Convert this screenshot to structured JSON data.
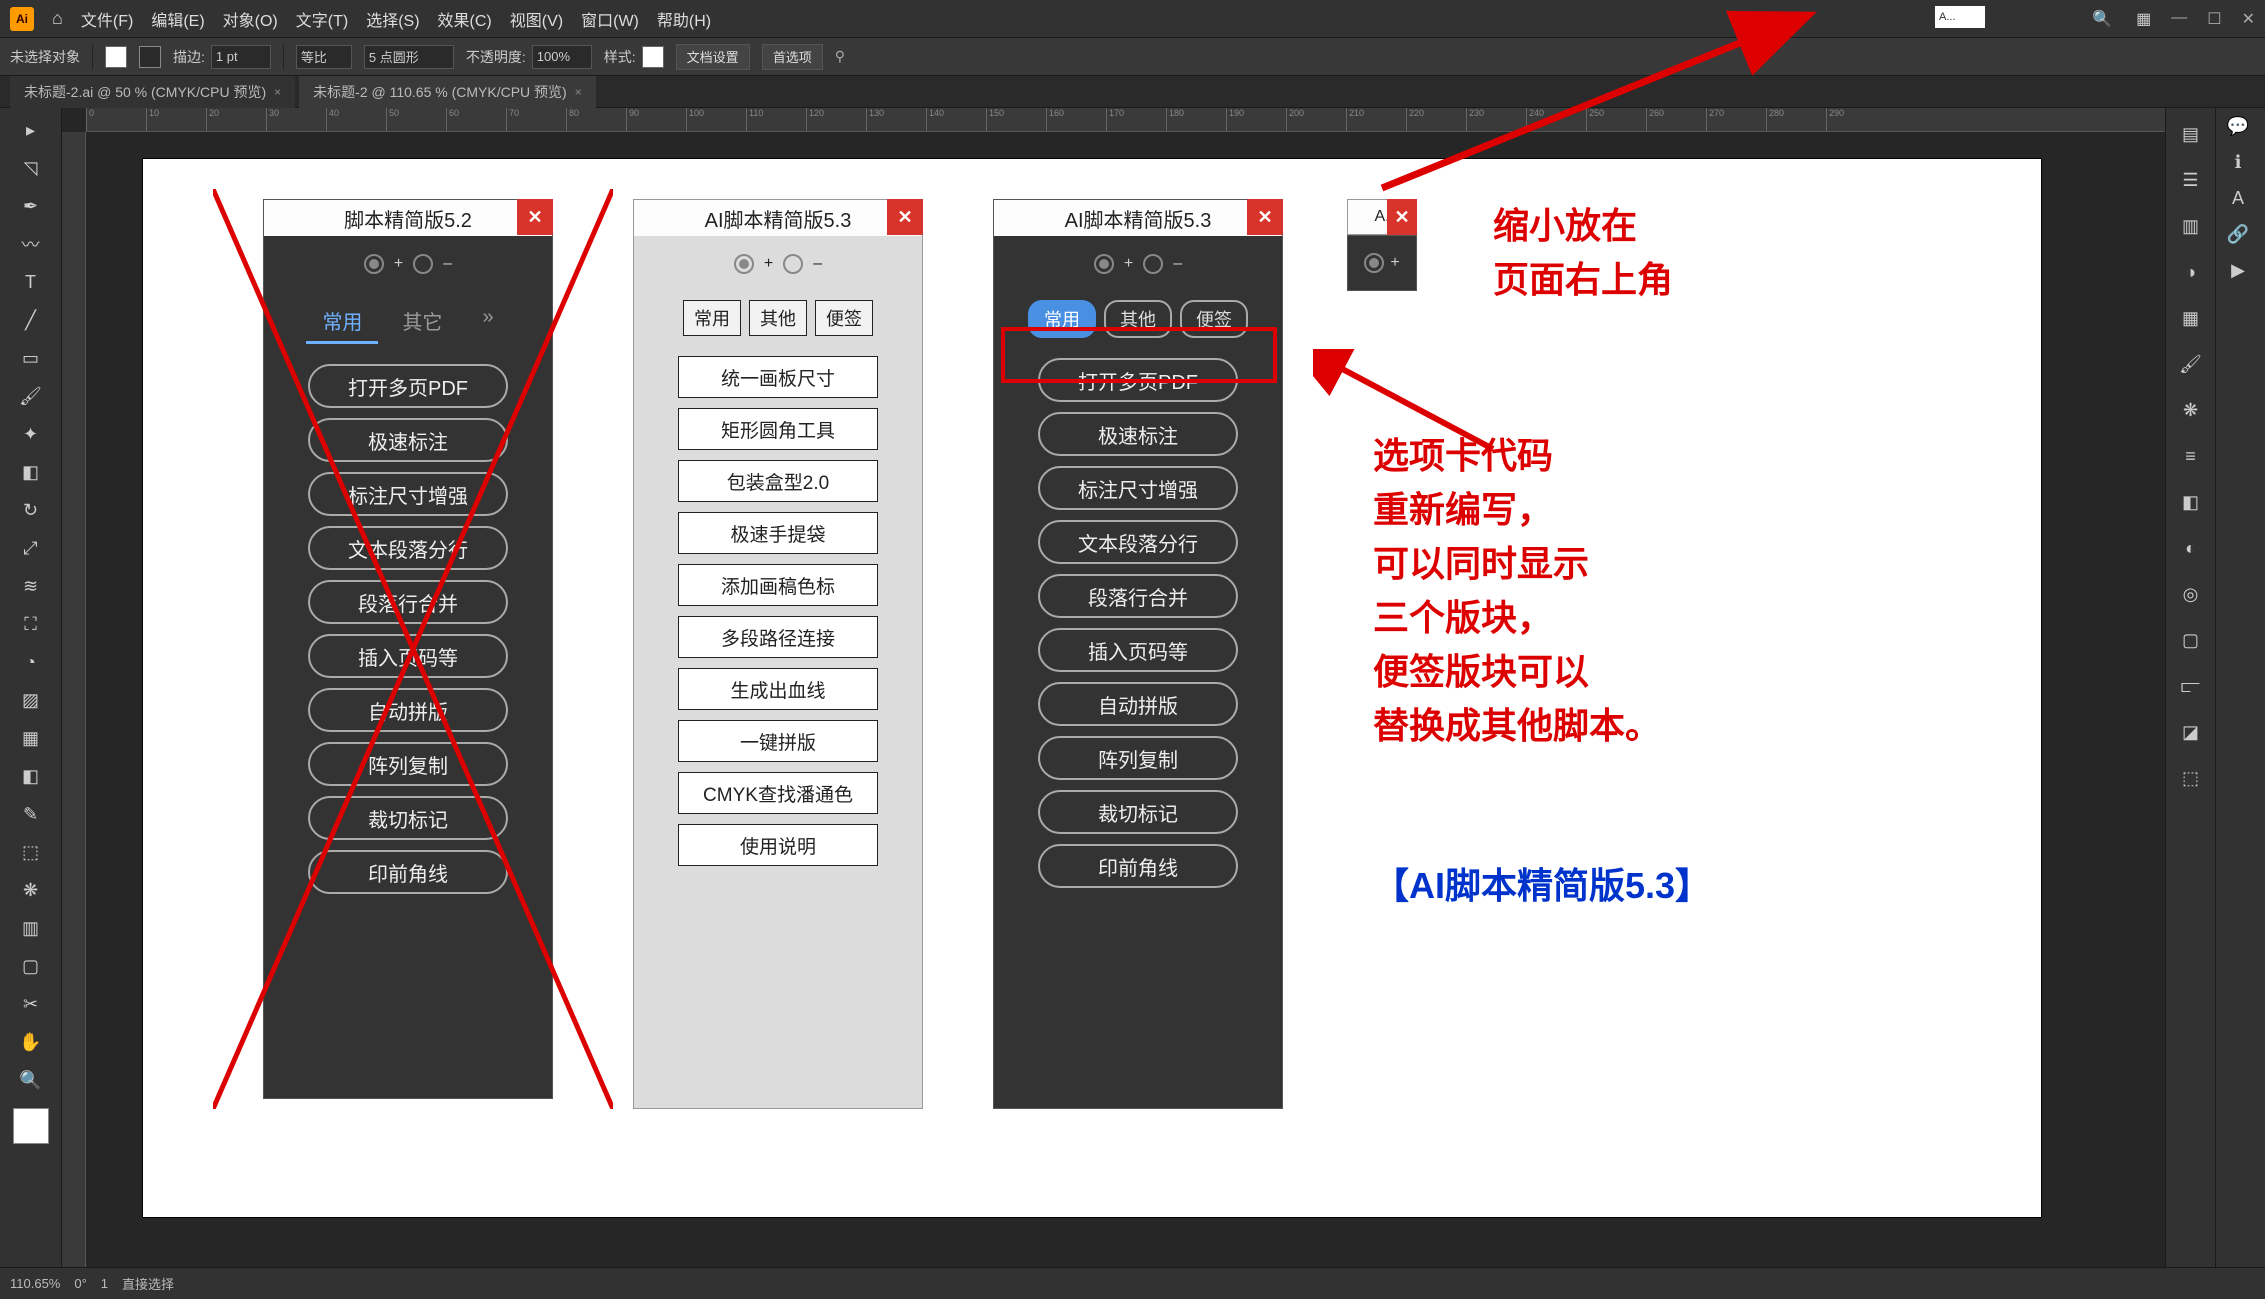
{
  "app": {
    "logo": "Ai"
  },
  "menu": [
    "文件(F)",
    "编辑(E)",
    "对象(O)",
    "文字(T)",
    "选择(S)",
    "效果(C)",
    "视图(V)",
    "窗口(W)",
    "帮助(H)"
  ],
  "search_chip": "A...",
  "control": {
    "no_selection": "未选择对象",
    "stroke_label": "描边:",
    "stroke_value": "1 pt",
    "uniform": "等比",
    "pt_round": "5 点圆形",
    "opacity_label": "不透明度:",
    "opacity_value": "100%",
    "style_label": "样式:",
    "doc_setup": "文档设置",
    "prefs": "首选项"
  },
  "tabs": [
    {
      "label": "未标题-2.ai @ 50 % (CMYK/CPU 预览)",
      "close": "×"
    },
    {
      "label": "未标题-2 @ 110.65 % (CMYK/CPU 预览)",
      "close": "×"
    }
  ],
  "ruler_ticks": [
    "0",
    "10",
    "20",
    "30",
    "40",
    "50",
    "60",
    "70",
    "80",
    "90",
    "100",
    "110",
    "120",
    "130",
    "140",
    "150",
    "160",
    "170",
    "180",
    "190",
    "200",
    "210",
    "220",
    "230",
    "240",
    "250",
    "260",
    "270",
    "280",
    "290"
  ],
  "panel52": {
    "title": "脚本精简版5.2",
    "tabs": [
      "常用",
      "其它"
    ],
    "buttons": [
      "打开多页PDF",
      "极速标注",
      "标注尺寸增强",
      "文本段落分行",
      "段落行合并",
      "插入页码等",
      "自动拼版",
      "阵列复制",
      "裁切标记",
      "印前角线"
    ]
  },
  "panel53light": {
    "title": "AI脚本精简版5.3",
    "tabs": [
      "常用",
      "其他",
      "便签"
    ],
    "buttons": [
      "统一画板尺寸",
      "矩形圆角工具",
      "包装盒型2.0",
      "极速手提袋",
      "添加画稿色标",
      "多段路径连接",
      "生成出血线",
      "一键拼版",
      "CMYK查找潘通色",
      "使用说明"
    ]
  },
  "panel53dark": {
    "title": "AI脚本精简版5.3",
    "tabs": [
      "常用",
      "其他",
      "便签"
    ],
    "buttons": [
      "打开多页PDF",
      "极速标注",
      "标注尺寸增强",
      "文本段落分行",
      "段落行合并",
      "插入页码等",
      "自动拼版",
      "阵列复制",
      "裁切标记",
      "印前角线"
    ]
  },
  "panel_mini": {
    "title": "A."
  },
  "annotations": {
    "a1_l1": "缩小放在",
    "a1_l2": "页面右上角",
    "a2_l1": "选项卡代码",
    "a2_l2": "重新编写，",
    "a2_l3": "可以同时显示",
    "a2_l4": "三个版块，",
    "a2_l5": "便签版块可以",
    "a2_l6": "替换成其他脚本。",
    "a3": "【AI脚本精简版5.3】"
  },
  "status": {
    "zoom": "110.65%",
    "rot": "0°",
    "artboard": "1",
    "mode": "直接选择"
  },
  "radio": {
    "plus": "+",
    "minus": "–"
  }
}
